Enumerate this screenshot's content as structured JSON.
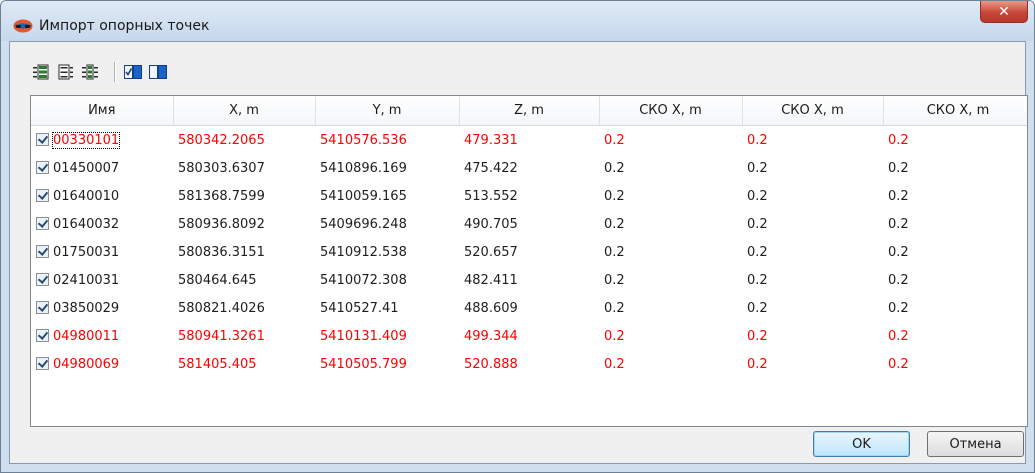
{
  "window": {
    "title": "Импорт опорных точек",
    "close_glyph": "✕"
  },
  "toolbar": {
    "buttons": [
      {
        "icon": "add-rows-icon"
      },
      {
        "icon": "list-icon"
      },
      {
        "icon": "columns-list-icon"
      },
      {
        "icon": "check-all-icon"
      },
      {
        "icon": "uncheck-all-icon"
      }
    ]
  },
  "table": {
    "headers": [
      "Имя",
      "X, m",
      "Y, m",
      "Z, m",
      "СКО X, m",
      "СКО X, m",
      "СКО X, m"
    ],
    "rows": [
      {
        "name": "00330101",
        "x": "580342.2065",
        "y": "5410576.536",
        "z": "479.331",
        "s1": "0.2",
        "s2": "0.2",
        "s3": "0.2",
        "checked": true,
        "highlight": true
      },
      {
        "name": "01450007",
        "x": "580303.6307",
        "y": "5410896.169",
        "z": "475.422",
        "s1": "0.2",
        "s2": "0.2",
        "s3": "0.2",
        "checked": true,
        "highlight": false
      },
      {
        "name": "01640010",
        "x": "581368.7599",
        "y": "5410059.165",
        "z": "513.552",
        "s1": "0.2",
        "s2": "0.2",
        "s3": "0.2",
        "checked": true,
        "highlight": false
      },
      {
        "name": "01640032",
        "x": "580936.8092",
        "y": "5409696.248",
        "z": "490.705",
        "s1": "0.2",
        "s2": "0.2",
        "s3": "0.2",
        "checked": true,
        "highlight": false
      },
      {
        "name": "01750031",
        "x": "580836.3151",
        "y": "5410912.538",
        "z": "520.657",
        "s1": "0.2",
        "s2": "0.2",
        "s3": "0.2",
        "checked": true,
        "highlight": false
      },
      {
        "name": "02410031",
        "x": "580464.645",
        "y": "5410072.308",
        "z": "482.411",
        "s1": "0.2",
        "s2": "0.2",
        "s3": "0.2",
        "checked": true,
        "highlight": false
      },
      {
        "name": "03850029",
        "x": "580821.4026",
        "y": "5410527.41",
        "z": "488.609",
        "s1": "0.2",
        "s2": "0.2",
        "s3": "0.2",
        "checked": true,
        "highlight": false
      },
      {
        "name": "04980011",
        "x": "580941.3261",
        "y": "5410131.409",
        "z": "499.344",
        "s1": "0.2",
        "s2": "0.2",
        "s3": "0.2",
        "checked": true,
        "highlight": true
      },
      {
        "name": "04980069",
        "x": "581405.405",
        "y": "5410505.799",
        "z": "520.888",
        "s1": "0.2",
        "s2": "0.2",
        "s3": "0.2",
        "checked": true,
        "highlight": true
      }
    ]
  },
  "buttons": {
    "ok": "OK",
    "cancel": "Отмена"
  },
  "colors": {
    "highlight_text": "#ff0000",
    "normal_text": "#1e1e1e"
  }
}
